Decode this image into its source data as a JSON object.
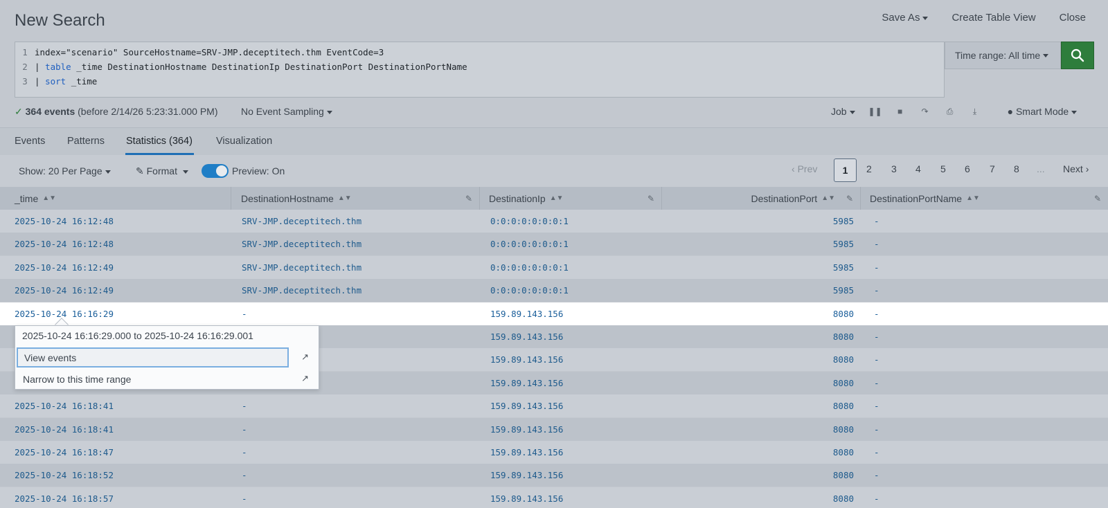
{
  "header": {
    "title": "New Search",
    "save_as": "Save As",
    "create_table_view": "Create Table View",
    "close": "Close"
  },
  "search": {
    "lines": [
      {
        "num": "1",
        "text": "index=\"scenario\" SourceHostname=SRV-JMP.deceptitech.thm EventCode=3"
      },
      {
        "num": "2",
        "pipe": "| ",
        "keyword": "table",
        "text": " _time DestinationHostname DestinationIp DestinationPort DestinationPortName"
      },
      {
        "num": "3",
        "pipe": "| ",
        "keyword": "sort",
        "text": " _time"
      }
    ],
    "time_range": "Time range: All time"
  },
  "status": {
    "check": "✓",
    "count": "364 events",
    "detail": "(before 2/14/26 5:23:31.000 PM)",
    "sampling": "No Event Sampling",
    "job": "Job",
    "mode": "Smart Mode"
  },
  "tabs": [
    {
      "label": "Events"
    },
    {
      "label": "Patterns"
    },
    {
      "label": "Statistics (364)"
    },
    {
      "label": "Visualization"
    }
  ],
  "toolbar": {
    "show": "Show: 20 Per Page",
    "format": "Format",
    "preview": "Preview: On",
    "prev": "Prev",
    "pages": [
      "1",
      "2",
      "3",
      "4",
      "5",
      "6",
      "7",
      "8"
    ],
    "ellipsis": "...",
    "next": "Next"
  },
  "table": {
    "columns": [
      "_time",
      "DestinationHostname",
      "DestinationIp",
      "DestinationPort",
      "DestinationPortName"
    ],
    "rows": [
      [
        "2025-10-24 16:12:48",
        "SRV-JMP.deceptitech.thm",
        "0:0:0:0:0:0:0:1",
        "5985",
        "-"
      ],
      [
        "2025-10-24 16:12:48",
        "SRV-JMP.deceptitech.thm",
        "0:0:0:0:0:0:0:1",
        "5985",
        "-"
      ],
      [
        "2025-10-24 16:12:49",
        "SRV-JMP.deceptitech.thm",
        "0:0:0:0:0:0:0:1",
        "5985",
        "-"
      ],
      [
        "2025-10-24 16:12:49",
        "SRV-JMP.deceptitech.thm",
        "0:0:0:0:0:0:0:1",
        "5985",
        "-"
      ],
      [
        "2025-10-24 16:16:29",
        "-",
        "159.89.143.156",
        "8080",
        "-"
      ],
      [
        "",
        "",
        "159.89.143.156",
        "8080",
        "-"
      ],
      [
        "",
        "",
        "159.89.143.156",
        "8080",
        "-"
      ],
      [
        "",
        "",
        "159.89.143.156",
        "8080",
        "-"
      ],
      [
        "2025-10-24 16:18:41",
        "-",
        "159.89.143.156",
        "8080",
        "-"
      ],
      [
        "2025-10-24 16:18:41",
        "-",
        "159.89.143.156",
        "8080",
        "-"
      ],
      [
        "2025-10-24 16:18:47",
        "-",
        "159.89.143.156",
        "8080",
        "-"
      ],
      [
        "2025-10-24 16:18:52",
        "-",
        "159.89.143.156",
        "8080",
        "-"
      ],
      [
        "2025-10-24 16:18:57",
        "-",
        "159.89.143.156",
        "8080",
        "-"
      ]
    ]
  },
  "popover": {
    "title": "2025-10-24 16:16:29.000 to 2025-10-24 16:16:29.001",
    "view_events": "View events",
    "narrow": "Narrow to this time range"
  }
}
